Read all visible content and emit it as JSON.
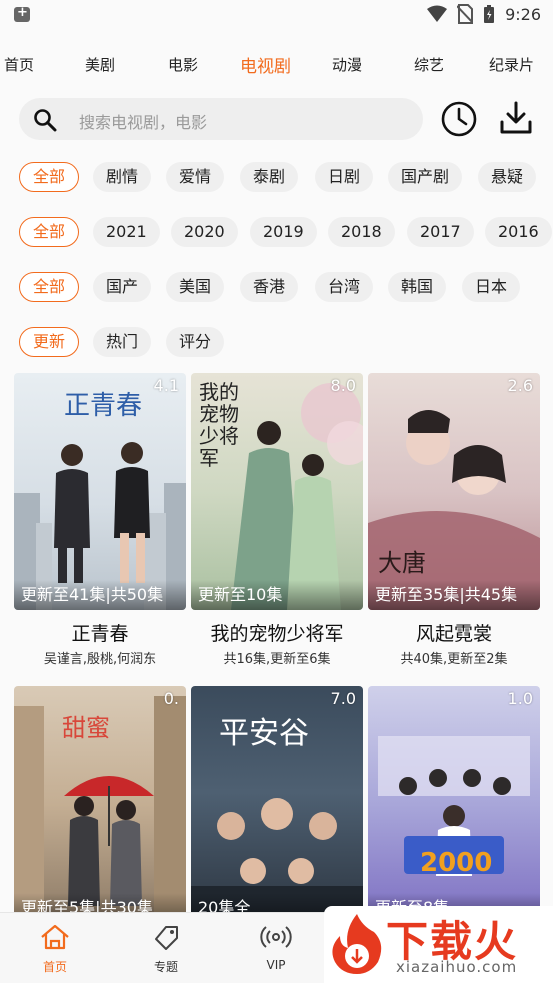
{
  "status_bar": {
    "time": "9:26"
  },
  "top_tabs": [
    {
      "label": "首页"
    },
    {
      "label": "美剧"
    },
    {
      "label": "电影"
    },
    {
      "label": "电视剧",
      "active": true
    },
    {
      "label": "动漫"
    },
    {
      "label": "综艺"
    },
    {
      "label": "纪录片"
    }
  ],
  "search": {
    "placeholder": "搜索电视剧，电影"
  },
  "filters": {
    "genre": [
      "全部",
      "剧情",
      "爱情",
      "泰剧",
      "日剧",
      "国产剧",
      "悬疑"
    ],
    "year": [
      "全部",
      "2021",
      "2020",
      "2019",
      "2018",
      "2017",
      "2016"
    ],
    "region": [
      "全部",
      "国产",
      "美国",
      "香港",
      "台湾",
      "韩国",
      "日本"
    ],
    "sort": [
      "更新",
      "热门",
      "评分"
    ]
  },
  "cards": [
    {
      "score": "4.1",
      "update": "更新至41集|共50集",
      "title": "正青春",
      "sub": "吴谨言,殷桃,何润东",
      "poster_title": "正青春"
    },
    {
      "score": "8.0",
      "update": "更新至10集",
      "title": "我的宠物少将军",
      "sub": "共16集,更新至6集",
      "poster_title": "我的宠物少将军"
    },
    {
      "score": "2.6",
      "update": "更新至35集|共45集",
      "title": "风起霓裳",
      "sub": "共40集,更新至2集",
      "poster_title": "大唐"
    },
    {
      "score": "0.",
      "update": "更新至5集|共30集",
      "title": "",
      "sub": "",
      "poster_title": "甜蜜"
    },
    {
      "score": "7.0",
      "update": "20集全",
      "title": "",
      "sub": "",
      "poster_title": "平安谷"
    },
    {
      "score": "1.0",
      "update": "更新至8集",
      "title": "",
      "sub": "",
      "poster_title": "2000"
    }
  ],
  "bottom_nav": [
    {
      "label": "首页",
      "icon": "home-icon",
      "active": true
    },
    {
      "label": "专题",
      "icon": "tag-icon"
    },
    {
      "label": "VIP",
      "icon": "broadcast-icon"
    }
  ],
  "watermark": {
    "cn": "下载火",
    "en": "xiazaihuo.com"
  },
  "colors": {
    "accent": "#f26b1d",
    "chip_bg": "#efefef",
    "watermark_red": "#e63a1f"
  }
}
